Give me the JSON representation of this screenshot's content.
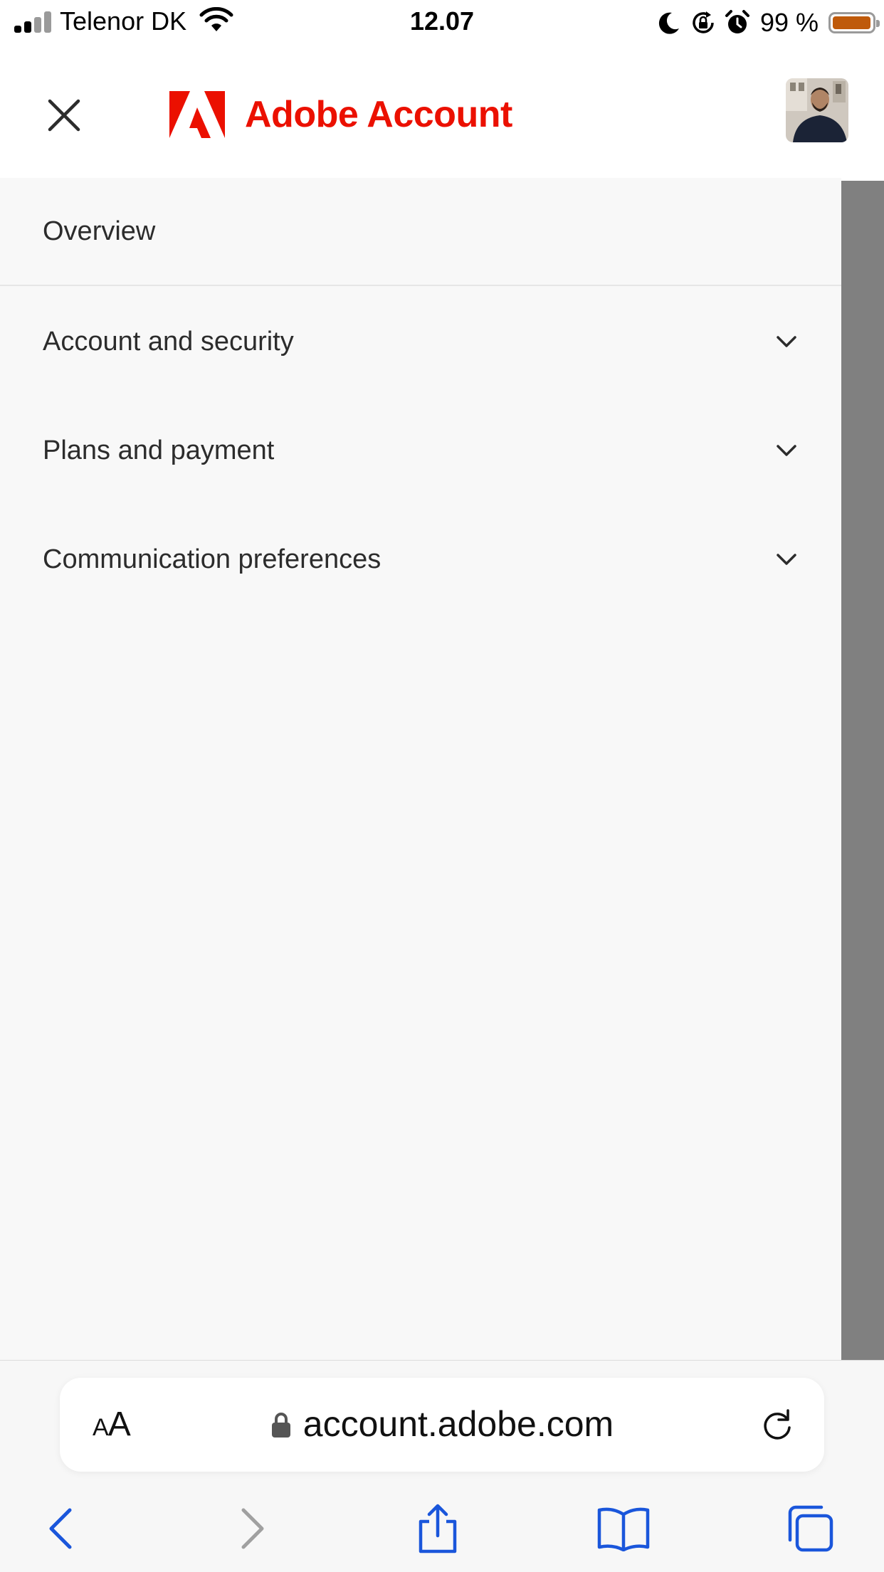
{
  "status_bar": {
    "carrier": "Telenor DK",
    "time": "12.07",
    "battery_percent": "99 %",
    "battery_level": 0.99,
    "icons": [
      "signal-icon",
      "wifi-icon",
      "moon-icon",
      "orientation-lock-icon",
      "alarm-icon",
      "battery-icon"
    ]
  },
  "header": {
    "brand_name": "Adobe Account",
    "close_icon": "close-icon",
    "brand_icon": "adobe-logo"
  },
  "menu": {
    "items": [
      {
        "label": "Overview",
        "expandable": false
      },
      {
        "label": "Account and security",
        "expandable": true
      },
      {
        "label": "Plans and payment",
        "expandable": true
      },
      {
        "label": "Communication preferences",
        "expandable": true
      }
    ]
  },
  "browser": {
    "text_size_label_small": "A",
    "text_size_label_large": "A",
    "url": "account.adobe.com",
    "toolbar": [
      "back-icon",
      "forward-icon",
      "share-icon",
      "bookmarks-icon",
      "tabs-icon"
    ]
  },
  "colors": {
    "brand": "#eb1000",
    "accent": "#1a56db",
    "battery": "#bf5a0b",
    "disabled": "#a0a0a0",
    "scrim": "#808080",
    "panel": "#f8f8f8"
  }
}
